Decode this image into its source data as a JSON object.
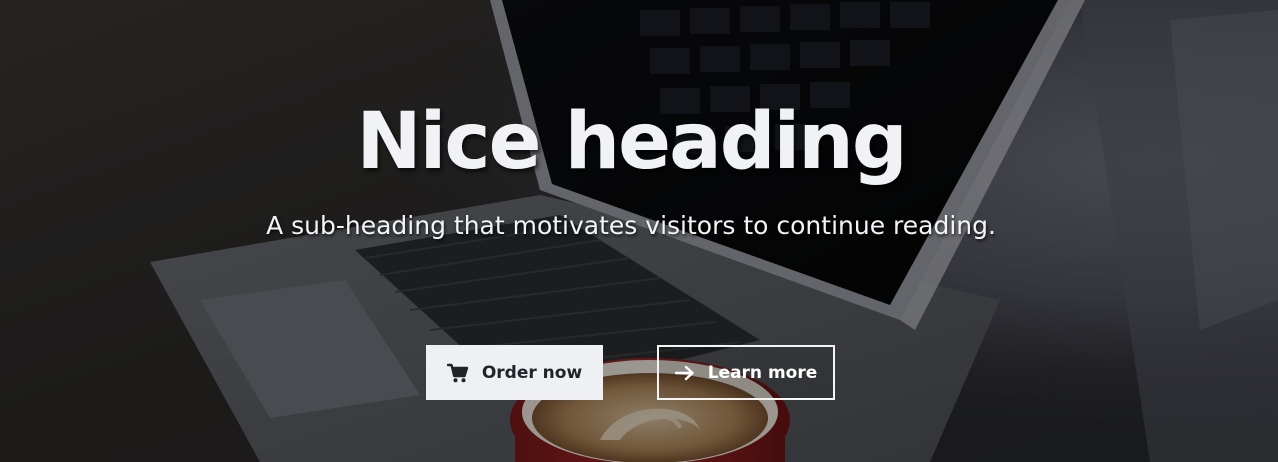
{
  "hero": {
    "heading": "Nice heading",
    "subheading": "A sub-heading that motivates visitors to continue reading."
  },
  "buttons": {
    "primary": {
      "label": "Order now",
      "icon": "cart-icon"
    },
    "secondary": {
      "label": "Learn more",
      "icon": "arrow-right-icon"
    }
  },
  "colors": {
    "heading_text": "#f1f2f5",
    "primary_bg": "#eef0f3",
    "primary_text": "#212529",
    "secondary_border": "#f5f5f5"
  }
}
